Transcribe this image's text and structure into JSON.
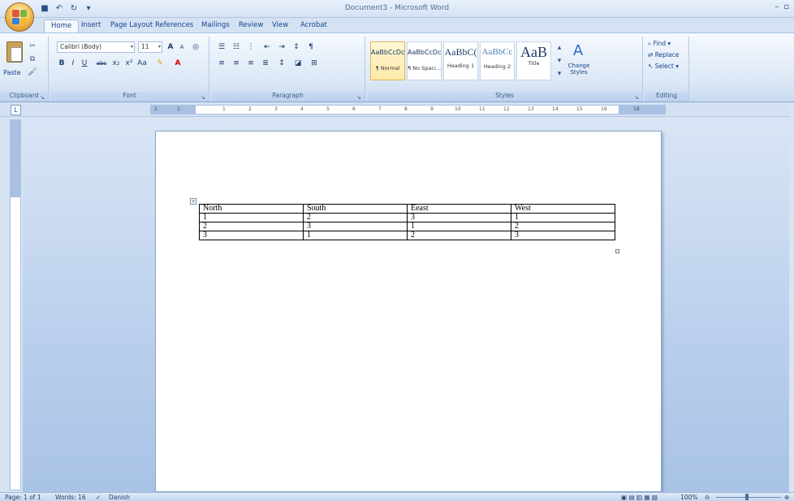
{
  "window": {
    "title": "Document3 - Microsoft Word",
    "controls": [
      "–",
      "▫"
    ]
  },
  "quick_access": {
    "icons": [
      "save-icon",
      "undo-icon",
      "redo-icon",
      "customize-icon"
    ]
  },
  "tabs": [
    {
      "label": "Home",
      "active": true
    },
    {
      "label": "Insert"
    },
    {
      "label": "Page Layout"
    },
    {
      "label": "References"
    },
    {
      "label": "Mailings"
    },
    {
      "label": "Review"
    },
    {
      "label": "View"
    },
    {
      "label": "Acrobat"
    }
  ],
  "ribbon": {
    "clipboard": {
      "label": "Clipboard",
      "paste": "Paste"
    },
    "font": {
      "label": "Font",
      "font_name": "Calibri (Body)",
      "font_size": "11",
      "buttons": [
        "B",
        "I",
        "U",
        "abc",
        "x₂",
        "x²",
        "Aa"
      ]
    },
    "paragraph": {
      "label": "Paragraph"
    },
    "styles": {
      "label": "Styles",
      "items": [
        {
          "sample": "AaBbCcDc",
          "name": "¶ Normal",
          "selected": true
        },
        {
          "sample": "AaBbCcDc",
          "name": "¶ No Spaci..."
        },
        {
          "sample": "AaBbC(",
          "name": "Heading 1"
        },
        {
          "sample": "AaBbCc",
          "name": "Heading 2"
        },
        {
          "sample": "AaB",
          "name": "Title"
        }
      ],
      "change_styles": "Change Styles"
    },
    "editing": {
      "label": "Editing",
      "find": "Find",
      "replace": "Replace",
      "select": "Select"
    }
  },
  "ruler": {
    "numbers": [
      "2",
      "1",
      "1",
      "2",
      "3",
      "4",
      "5",
      "6",
      "7",
      "8",
      "9",
      "10",
      "11",
      "12",
      "13",
      "14",
      "15",
      "16",
      "18"
    ]
  },
  "document": {
    "table": {
      "header": [
        "North",
        "South",
        "Eeast",
        "West"
      ],
      "rows": [
        [
          "1",
          "2",
          "3",
          "1"
        ],
        [
          "2",
          "3",
          "1",
          "2"
        ],
        [
          "3",
          "1",
          "2",
          "3"
        ]
      ]
    }
  },
  "status": {
    "page": "Page: 1 of 1",
    "words": "Words: 16",
    "language": "Danish",
    "zoom": "100%"
  },
  "colors": {
    "accent": "#15428b",
    "ribbon": "#dce8f6",
    "workspace": "#b9cfec"
  }
}
